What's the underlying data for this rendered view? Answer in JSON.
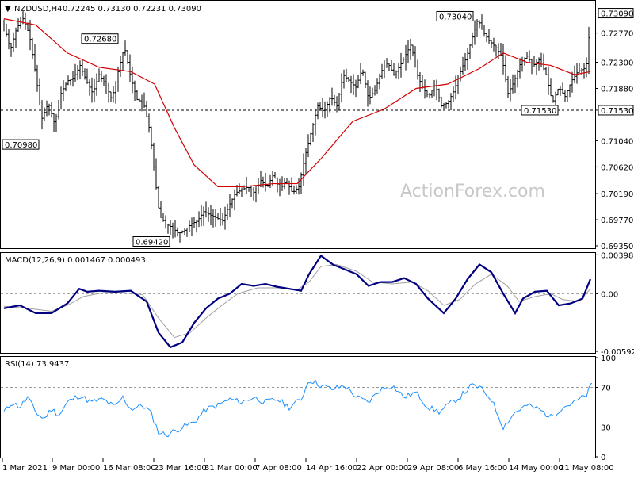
{
  "chart_data": [
    {
      "type": "candlestick",
      "panel": "price",
      "title": "NZDUSD,H4",
      "ohlc_header": "0.72245 0.73130 0.72231 0.73090",
      "last_price_label": "0.73090",
      "watermark": "ActionForex.com",
      "ylim": [
        0.6935,
        0.7325
      ],
      "y_ticks": [
        "0.73090",
        "0.72770",
        "0.72300",
        "0.71880",
        "0.71530",
        "0.71040",
        "0.70620",
        "0.70190",
        "0.69770",
        "0.69350"
      ],
      "reference_lines": [
        {
          "value": 0.7309,
          "style": "dashed-gray"
        },
        {
          "value": 0.7153,
          "style": "dashed-black"
        }
      ],
      "annotations": [
        {
          "label": "0.70980",
          "value": 0.7098,
          "date": "1 Mar 2021"
        },
        {
          "label": "0.72680",
          "value": 0.7268,
          "date": "12 Mar 2021"
        },
        {
          "label": "0.69420",
          "value": 0.6942,
          "date": "24 Mar 2021"
        },
        {
          "label": "0.73040",
          "value": 0.7304,
          "date": "6 May 2021"
        },
        {
          "label": "0.71530",
          "value": 0.7153,
          "date": "20 May 2021"
        }
      ],
      "price_path": [
        [
          0,
          0.729
        ],
        [
          8,
          0.725
        ],
        [
          16,
          0.7285
        ],
        [
          24,
          0.73
        ],
        [
          32,
          0.7275
        ],
        [
          40,
          0.721
        ],
        [
          48,
          0.714
        ],
        [
          56,
          0.7165
        ],
        [
          64,
          0.713
        ],
        [
          72,
          0.718
        ],
        [
          80,
          0.72
        ],
        [
          88,
          0.7205
        ],
        [
          96,
          0.7225
        ],
        [
          104,
          0.72
        ],
        [
          112,
          0.718
        ],
        [
          120,
          0.721
        ],
        [
          128,
          0.7195
        ],
        [
          136,
          0.717
        ],
        [
          144,
          0.7215
        ],
        [
          152,
          0.7255
        ],
        [
          160,
          0.7205
        ],
        [
          168,
          0.717
        ],
        [
          176,
          0.7165
        ],
        [
          184,
          0.712
        ],
        [
          190,
          0.705
        ],
        [
          196,
          0.6985
        ],
        [
          204,
          0.697
        ],
        [
          212,
          0.6965
        ],
        [
          220,
          0.6955
        ],
        [
          228,
          0.696
        ],
        [
          236,
          0.697
        ],
        [
          244,
          0.6975
        ],
        [
          252,
          0.699
        ],
        [
          260,
          0.6985
        ],
        [
          268,
          0.698
        ],
        [
          276,
          0.6975
        ],
        [
          284,
          0.7
        ],
        [
          292,
          0.702
        ],
        [
          300,
          0.7025
        ],
        [
          308,
          0.703
        ],
        [
          316,
          0.702
        ],
        [
          324,
          0.704
        ],
        [
          332,
          0.703
        ],
        [
          340,
          0.705
        ],
        [
          348,
          0.7025
        ],
        [
          356,
          0.704
        ],
        [
          364,
          0.702
        ],
        [
          372,
          0.703
        ],
        [
          380,
          0.708
        ],
        [
          388,
          0.712
        ],
        [
          396,
          0.716
        ],
        [
          404,
          0.715
        ],
        [
          412,
          0.7175
        ],
        [
          420,
          0.716
        ],
        [
          428,
          0.721
        ],
        [
          436,
          0.72
        ],
        [
          444,
          0.719
        ],
        [
          452,
          0.722
        ],
        [
          460,
          0.717
        ],
        [
          468,
          0.7185
        ],
        [
          476,
          0.7215
        ],
        [
          484,
          0.723
        ],
        [
          492,
          0.721
        ],
        [
          500,
          0.7225
        ],
        [
          508,
          0.7245
        ],
        [
          514,
          0.726
        ],
        [
          520,
          0.7215
        ],
        [
          528,
          0.719
        ],
        [
          536,
          0.7175
        ],
        [
          544,
          0.7195
        ],
        [
          552,
          0.716
        ],
        [
          560,
          0.7165
        ],
        [
          568,
          0.7185
        ],
        [
          576,
          0.7215
        ],
        [
          584,
          0.724
        ],
        [
          592,
          0.7275
        ],
        [
          598,
          0.73
        ],
        [
          604,
          0.728
        ],
        [
          612,
          0.7265
        ],
        [
          620,
          0.7255
        ],
        [
          628,
          0.724
        ],
        [
          636,
          0.718
        ],
        [
          644,
          0.72
        ],
        [
          652,
          0.723
        ],
        [
          660,
          0.724
        ],
        [
          668,
          0.7225
        ],
        [
          676,
          0.7235
        ],
        [
          684,
          0.721
        ],
        [
          692,
          0.7165
        ],
        [
          700,
          0.719
        ],
        [
          708,
          0.7175
        ],
        [
          716,
          0.72
        ],
        [
          724,
          0.7215
        ],
        [
          732,
          0.722
        ],
        [
          736,
          0.723
        ],
        [
          740,
          0.7309
        ]
      ],
      "ma_path": [
        [
          0,
          0.73
        ],
        [
          40,
          0.729
        ],
        [
          80,
          0.7245
        ],
        [
          120,
          0.7222
        ],
        [
          160,
          0.7215
        ],
        [
          190,
          0.7195
        ],
        [
          215,
          0.7125
        ],
        [
          240,
          0.7065
        ],
        [
          270,
          0.703
        ],
        [
          300,
          0.703
        ],
        [
          340,
          0.7035
        ],
        [
          370,
          0.7035
        ],
        [
          400,
          0.7075
        ],
        [
          440,
          0.7135
        ],
        [
          480,
          0.7155
        ],
        [
          520,
          0.7188
        ],
        [
          560,
          0.7195
        ],
        [
          600,
          0.722
        ],
        [
          630,
          0.7245
        ],
        [
          660,
          0.723
        ],
        [
          690,
          0.7225
        ],
        [
          720,
          0.721
        ],
        [
          740,
          0.7215
        ]
      ]
    },
    {
      "type": "line",
      "panel": "macd",
      "label": "MACD(12,26,9) 0.001467 0.000493",
      "ylim": [
        -0.006,
        0.0041
      ],
      "y_ticks": [
        "0.003988",
        "0.00",
        "-0.005924"
      ],
      "macd_path": [
        [
          0,
          -0.0015
        ],
        [
          20,
          -0.0012
        ],
        [
          40,
          -0.002
        ],
        [
          60,
          -0.002
        ],
        [
          80,
          -0.001
        ],
        [
          95,
          0.0005
        ],
        [
          105,
          0.0002
        ],
        [
          120,
          0.0003
        ],
        [
          140,
          0.0002
        ],
        [
          160,
          0.0003
        ],
        [
          180,
          -0.0008
        ],
        [
          195,
          -0.004
        ],
        [
          210,
          -0.0055
        ],
        [
          225,
          -0.005
        ],
        [
          240,
          -0.003
        ],
        [
          255,
          -0.0015
        ],
        [
          270,
          -0.0005
        ],
        [
          285,
          0.0
        ],
        [
          300,
          0.001
        ],
        [
          315,
          0.0008
        ],
        [
          330,
          0.001
        ],
        [
          345,
          0.0007
        ],
        [
          360,
          0.0005
        ],
        [
          375,
          0.0003
        ],
        [
          385,
          0.002
        ],
        [
          400,
          0.0039
        ],
        [
          415,
          0.003
        ],
        [
          430,
          0.0025
        ],
        [
          445,
          0.002
        ],
        [
          460,
          0.0008
        ],
        [
          475,
          0.0012
        ],
        [
          490,
          0.0012
        ],
        [
          505,
          0.0016
        ],
        [
          520,
          0.001
        ],
        [
          535,
          -0.0005
        ],
        [
          555,
          -0.002
        ],
        [
          570,
          -0.0005
        ],
        [
          585,
          0.0015
        ],
        [
          600,
          0.003
        ],
        [
          615,
          0.0022
        ],
        [
          630,
          0.0
        ],
        [
          645,
          -0.002
        ],
        [
          655,
          -0.0005
        ],
        [
          670,
          0.0002
        ],
        [
          685,
          0.0003
        ],
        [
          700,
          -0.0012
        ],
        [
          715,
          -0.001
        ],
        [
          730,
          -0.0005
        ],
        [
          740,
          0.0015
        ]
      ],
      "signal_path": [
        [
          0,
          -0.0013
        ],
        [
          30,
          -0.0015
        ],
        [
          60,
          -0.0018
        ],
        [
          80,
          -0.0012
        ],
        [
          100,
          -0.0003
        ],
        [
          125,
          0.0001
        ],
        [
          150,
          0.0001
        ],
        [
          175,
          -0.0001
        ],
        [
          195,
          -0.0025
        ],
        [
          215,
          -0.0045
        ],
        [
          235,
          -0.004
        ],
        [
          255,
          -0.0025
        ],
        [
          275,
          -0.0012
        ],
        [
          295,
          0.0
        ],
        [
          320,
          0.0006
        ],
        [
          345,
          0.0006
        ],
        [
          370,
          0.0004
        ],
        [
          385,
          0.0012
        ],
        [
          400,
          0.0028
        ],
        [
          420,
          0.003
        ],
        [
          445,
          0.0023
        ],
        [
          465,
          0.0012
        ],
        [
          490,
          0.001
        ],
        [
          515,
          0.0012
        ],
        [
          535,
          0.0003
        ],
        [
          555,
          -0.0012
        ],
        [
          575,
          -0.0006
        ],
        [
          595,
          0.001
        ],
        [
          615,
          0.002
        ],
        [
          635,
          0.0008
        ],
        [
          650,
          -0.0008
        ],
        [
          670,
          -0.0003
        ],
        [
          690,
          0.0
        ],
        [
          705,
          -0.0006
        ],
        [
          725,
          -0.0008
        ],
        [
          740,
          0.0005
        ]
      ]
    },
    {
      "type": "line",
      "panel": "rsi",
      "label": "RSI(14) 73.9437",
      "ylim": [
        0,
        100
      ],
      "y_ticks": [
        "100",
        "70",
        "30",
        "0"
      ],
      "levels": [
        70,
        30
      ],
      "rsi_path": [
        [
          0,
          45
        ],
        [
          10,
          55
        ],
        [
          20,
          50
        ],
        [
          30,
          60
        ],
        [
          40,
          45
        ],
        [
          50,
          38
        ],
        [
          60,
          48
        ],
        [
          70,
          42
        ],
        [
          80,
          55
        ],
        [
          95,
          62
        ],
        [
          110,
          55
        ],
        [
          125,
          58
        ],
        [
          140,
          50
        ],
        [
          150,
          60
        ],
        [
          160,
          48
        ],
        [
          175,
          52
        ],
        [
          185,
          45
        ],
        [
          195,
          25
        ],
        [
          205,
          22
        ],
        [
          220,
          28
        ],
        [
          240,
          35
        ],
        [
          255,
          48
        ],
        [
          270,
          52
        ],
        [
          285,
          58
        ],
        [
          300,
          55
        ],
        [
          315,
          60
        ],
        [
          330,
          55
        ],
        [
          345,
          58
        ],
        [
          360,
          50
        ],
        [
          375,
          58
        ],
        [
          385,
          78
        ],
        [
          400,
          72
        ],
        [
          415,
          68
        ],
        [
          430,
          72
        ],
        [
          445,
          60
        ],
        [
          460,
          55
        ],
        [
          475,
          68
        ],
        [
          490,
          72
        ],
        [
          505,
          60
        ],
        [
          520,
          65
        ],
        [
          535,
          50
        ],
        [
          550,
          45
        ],
        [
          560,
          52
        ],
        [
          575,
          60
        ],
        [
          590,
          72
        ],
        [
          600,
          70
        ],
        [
          615,
          58
        ],
        [
          630,
          30
        ],
        [
          645,
          45
        ],
        [
          660,
          52
        ],
        [
          675,
          48
        ],
        [
          690,
          40
        ],
        [
          705,
          50
        ],
        [
          720,
          55
        ],
        [
          735,
          62
        ],
        [
          742,
          74
        ]
      ]
    }
  ],
  "x_axis_labels": [
    "1 Mar 2021",
    "9 Mar 00:00",
    "16 Mar 08:00",
    "23 Mar 16:00",
    "31 Mar 00:00",
    "7 Apr 08:00",
    "14 Apr 16:00",
    "22 Apr 00:00",
    "29 Apr 08:00",
    "6 May 16:00",
    "14 May 00:00",
    "21 May 08:00"
  ],
  "colors": {
    "price_bars": "#000000",
    "moving_average": "#d40000",
    "macd_line": "#000080",
    "signal_line": "#a0a0a0",
    "rsi_line": "#1e90ff",
    "grid_dashed": "#999999",
    "axis": "#000000"
  }
}
